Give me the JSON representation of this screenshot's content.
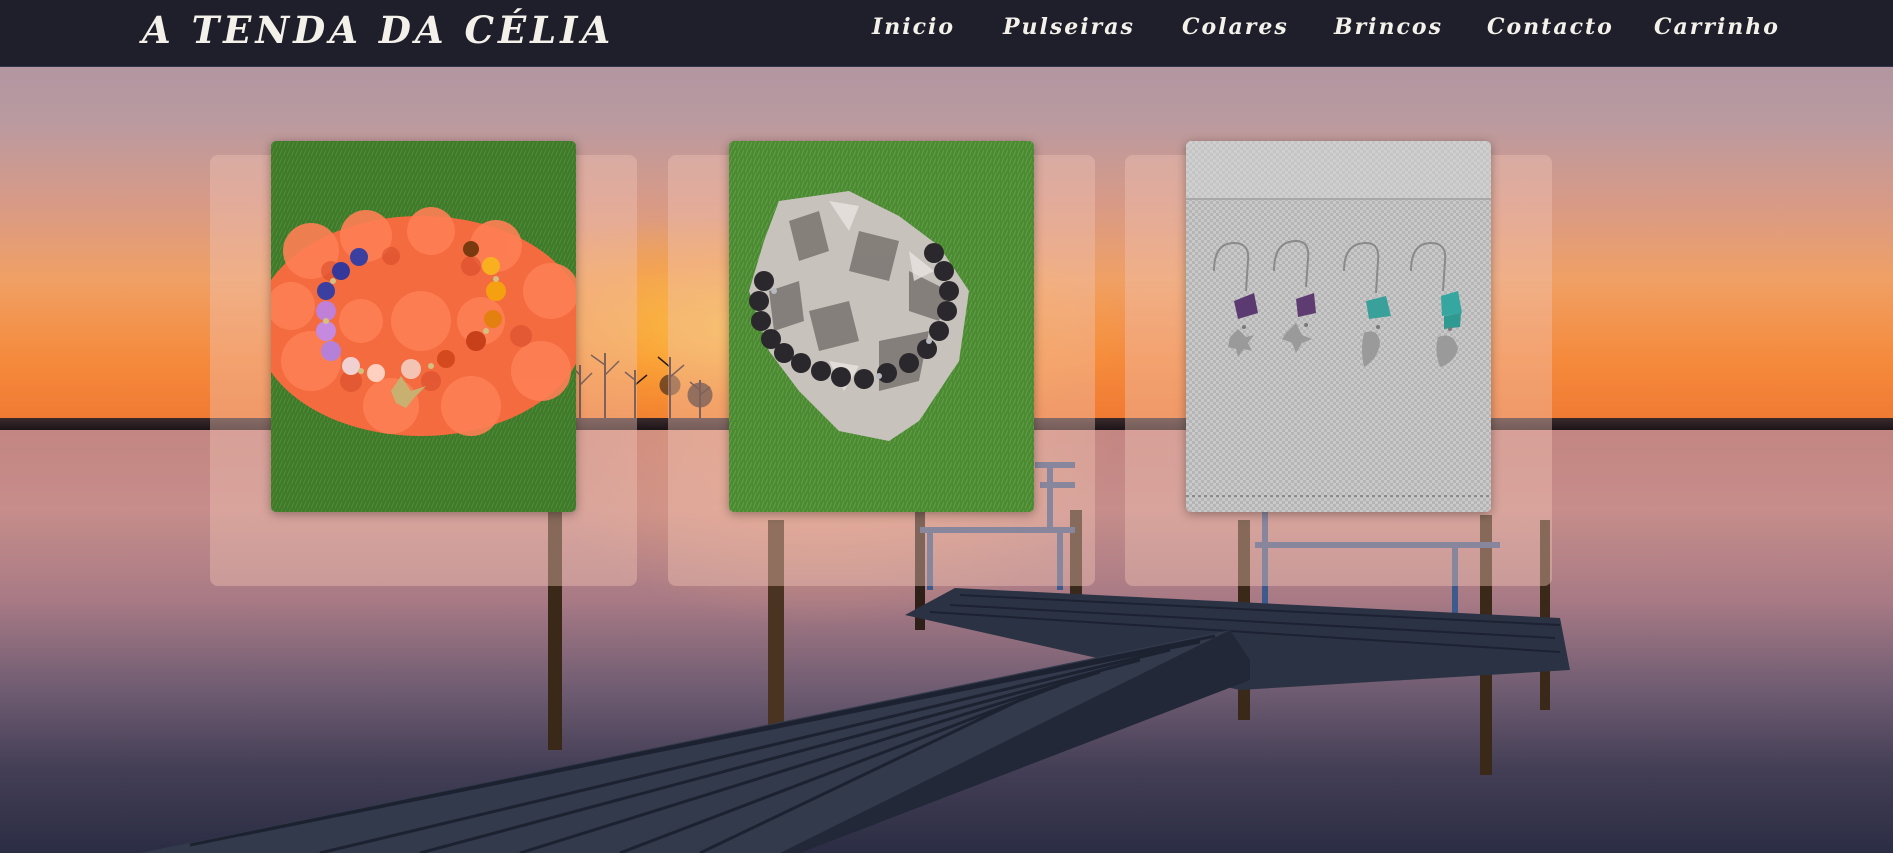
{
  "header": {
    "brand": "A TENDA DA CÉLIA",
    "nav": [
      {
        "label": "Inicio"
      },
      {
        "label": "Pulseiras"
      },
      {
        "label": "Colares"
      },
      {
        "label": "Brincos"
      },
      {
        "label": "Contacto"
      },
      {
        "label": "Carrinho"
      }
    ]
  },
  "colors": {
    "header_bg": "#1f1f2b",
    "header_text": "#f4f1ea"
  },
  "products": [
    {
      "image_subject": "bracelet-on-flowers"
    },
    {
      "image_subject": "lava-stone-bracelet-on-rock"
    },
    {
      "image_subject": "earrings-on-cloth"
    }
  ]
}
